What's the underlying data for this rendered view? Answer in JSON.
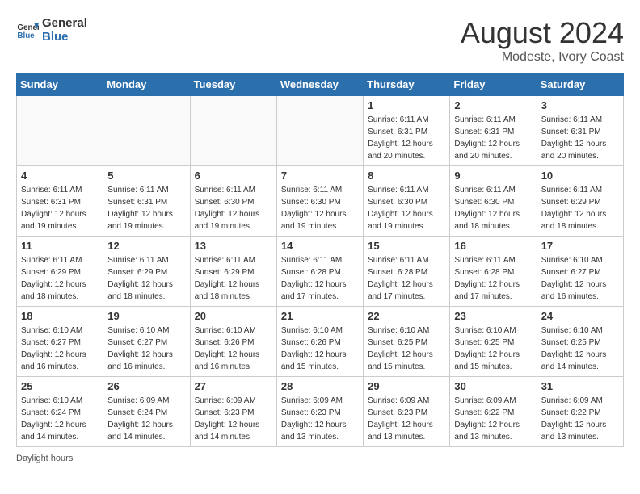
{
  "header": {
    "logo_line1": "General",
    "logo_line2": "Blue",
    "month_year": "August 2024",
    "location": "Modeste, Ivory Coast"
  },
  "days_of_week": [
    "Sunday",
    "Monday",
    "Tuesday",
    "Wednesday",
    "Thursday",
    "Friday",
    "Saturday"
  ],
  "weeks": [
    [
      {
        "day": "",
        "info": ""
      },
      {
        "day": "",
        "info": ""
      },
      {
        "day": "",
        "info": ""
      },
      {
        "day": "",
        "info": ""
      },
      {
        "day": "1",
        "info": "Sunrise: 6:11 AM\nSunset: 6:31 PM\nDaylight: 12 hours\nand 20 minutes."
      },
      {
        "day": "2",
        "info": "Sunrise: 6:11 AM\nSunset: 6:31 PM\nDaylight: 12 hours\nand 20 minutes."
      },
      {
        "day": "3",
        "info": "Sunrise: 6:11 AM\nSunset: 6:31 PM\nDaylight: 12 hours\nand 20 minutes."
      }
    ],
    [
      {
        "day": "4",
        "info": "Sunrise: 6:11 AM\nSunset: 6:31 PM\nDaylight: 12 hours\nand 19 minutes."
      },
      {
        "day": "5",
        "info": "Sunrise: 6:11 AM\nSunset: 6:31 PM\nDaylight: 12 hours\nand 19 minutes."
      },
      {
        "day": "6",
        "info": "Sunrise: 6:11 AM\nSunset: 6:30 PM\nDaylight: 12 hours\nand 19 minutes."
      },
      {
        "day": "7",
        "info": "Sunrise: 6:11 AM\nSunset: 6:30 PM\nDaylight: 12 hours\nand 19 minutes."
      },
      {
        "day": "8",
        "info": "Sunrise: 6:11 AM\nSunset: 6:30 PM\nDaylight: 12 hours\nand 19 minutes."
      },
      {
        "day": "9",
        "info": "Sunrise: 6:11 AM\nSunset: 6:30 PM\nDaylight: 12 hours\nand 18 minutes."
      },
      {
        "day": "10",
        "info": "Sunrise: 6:11 AM\nSunset: 6:29 PM\nDaylight: 12 hours\nand 18 minutes."
      }
    ],
    [
      {
        "day": "11",
        "info": "Sunrise: 6:11 AM\nSunset: 6:29 PM\nDaylight: 12 hours\nand 18 minutes."
      },
      {
        "day": "12",
        "info": "Sunrise: 6:11 AM\nSunset: 6:29 PM\nDaylight: 12 hours\nand 18 minutes."
      },
      {
        "day": "13",
        "info": "Sunrise: 6:11 AM\nSunset: 6:29 PM\nDaylight: 12 hours\nand 18 minutes."
      },
      {
        "day": "14",
        "info": "Sunrise: 6:11 AM\nSunset: 6:28 PM\nDaylight: 12 hours\nand 17 minutes."
      },
      {
        "day": "15",
        "info": "Sunrise: 6:11 AM\nSunset: 6:28 PM\nDaylight: 12 hours\nand 17 minutes."
      },
      {
        "day": "16",
        "info": "Sunrise: 6:11 AM\nSunset: 6:28 PM\nDaylight: 12 hours\nand 17 minutes."
      },
      {
        "day": "17",
        "info": "Sunrise: 6:10 AM\nSunset: 6:27 PM\nDaylight: 12 hours\nand 16 minutes."
      }
    ],
    [
      {
        "day": "18",
        "info": "Sunrise: 6:10 AM\nSunset: 6:27 PM\nDaylight: 12 hours\nand 16 minutes."
      },
      {
        "day": "19",
        "info": "Sunrise: 6:10 AM\nSunset: 6:27 PM\nDaylight: 12 hours\nand 16 minutes."
      },
      {
        "day": "20",
        "info": "Sunrise: 6:10 AM\nSunset: 6:26 PM\nDaylight: 12 hours\nand 16 minutes."
      },
      {
        "day": "21",
        "info": "Sunrise: 6:10 AM\nSunset: 6:26 PM\nDaylight: 12 hours\nand 15 minutes."
      },
      {
        "day": "22",
        "info": "Sunrise: 6:10 AM\nSunset: 6:25 PM\nDaylight: 12 hours\nand 15 minutes."
      },
      {
        "day": "23",
        "info": "Sunrise: 6:10 AM\nSunset: 6:25 PM\nDaylight: 12 hours\nand 15 minutes."
      },
      {
        "day": "24",
        "info": "Sunrise: 6:10 AM\nSunset: 6:25 PM\nDaylight: 12 hours\nand 14 minutes."
      }
    ],
    [
      {
        "day": "25",
        "info": "Sunrise: 6:10 AM\nSunset: 6:24 PM\nDaylight: 12 hours\nand 14 minutes."
      },
      {
        "day": "26",
        "info": "Sunrise: 6:09 AM\nSunset: 6:24 PM\nDaylight: 12 hours\nand 14 minutes."
      },
      {
        "day": "27",
        "info": "Sunrise: 6:09 AM\nSunset: 6:23 PM\nDaylight: 12 hours\nand 14 minutes."
      },
      {
        "day": "28",
        "info": "Sunrise: 6:09 AM\nSunset: 6:23 PM\nDaylight: 12 hours\nand 13 minutes."
      },
      {
        "day": "29",
        "info": "Sunrise: 6:09 AM\nSunset: 6:23 PM\nDaylight: 12 hours\nand 13 minutes."
      },
      {
        "day": "30",
        "info": "Sunrise: 6:09 AM\nSunset: 6:22 PM\nDaylight: 12 hours\nand 13 minutes."
      },
      {
        "day": "31",
        "info": "Sunrise: 6:09 AM\nSunset: 6:22 PM\nDaylight: 12 hours\nand 13 minutes."
      }
    ]
  ],
  "footer": {
    "note": "Daylight hours"
  }
}
